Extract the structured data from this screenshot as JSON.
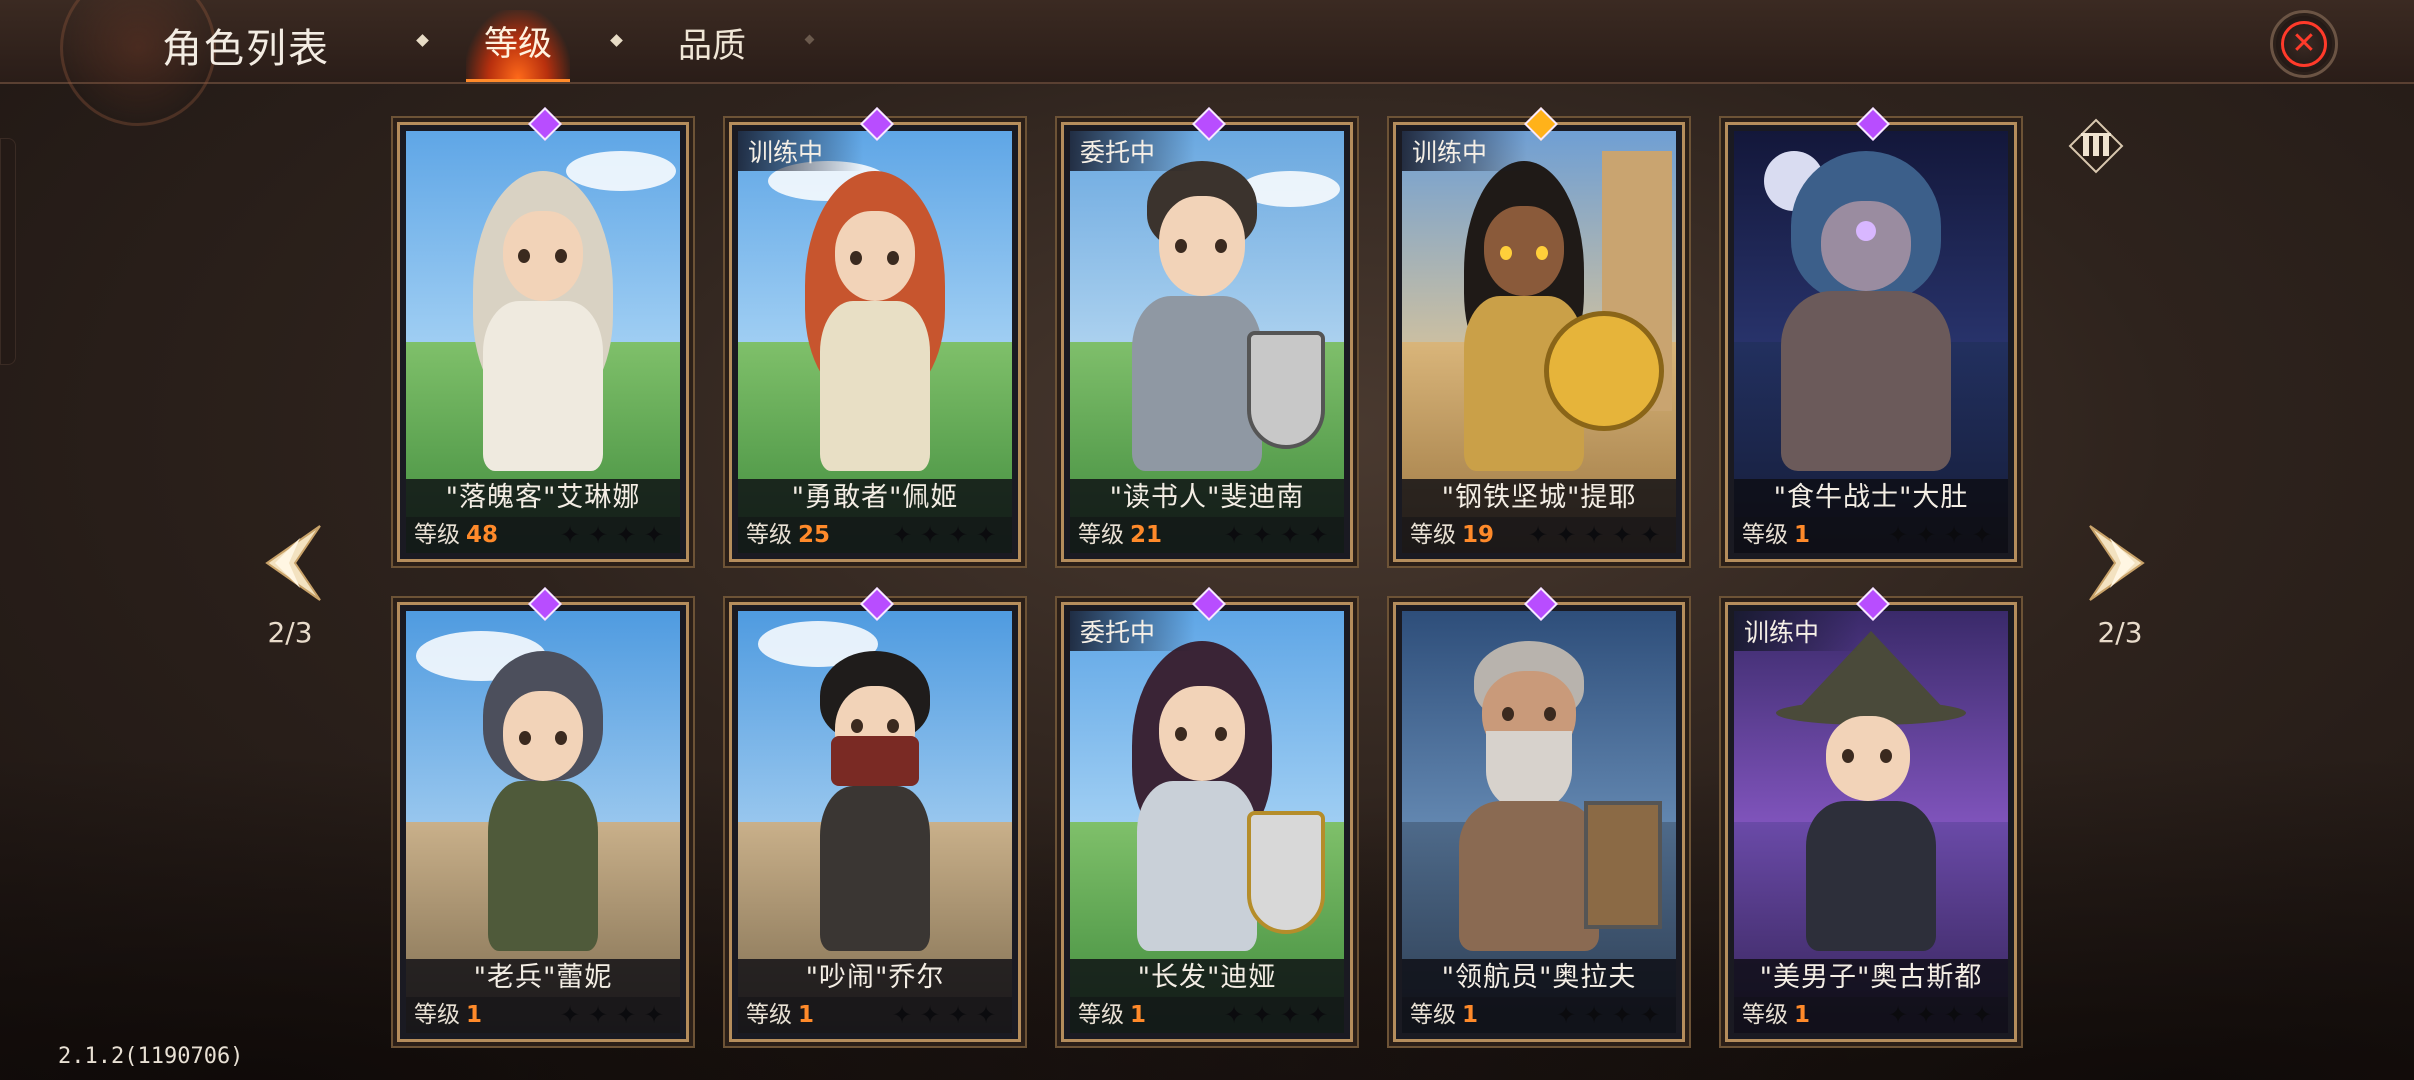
{
  "header": {
    "title": "角色列表",
    "tabs": [
      {
        "label": "等级",
        "active": true
      },
      {
        "label": "品质",
        "active": false
      }
    ]
  },
  "navigation": {
    "left_page": "2/3",
    "right_page": "2/3"
  },
  "version": "2.1.2(1190706)",
  "level_prefix": "等级",
  "cards": [
    {
      "name": "\"落魄客\"艾琳娜",
      "level": "48",
      "status": "",
      "gem": "purple",
      "stars": 4
    },
    {
      "name": "\"勇敢者\"佩姬",
      "level": "25",
      "status": "训练中",
      "gem": "purple",
      "stars": 4
    },
    {
      "name": "\"读书人\"斐迪南",
      "level": "21",
      "status": "委托中",
      "gem": "purple",
      "stars": 4
    },
    {
      "name": "\"钢铁坚城\"提耶",
      "level": "19",
      "status": "训练中",
      "gem": "gold",
      "stars": 5
    },
    {
      "name": "\"食牛战士\"大肚",
      "level": "1",
      "status": "",
      "gem": "purple",
      "stars": 4
    },
    {
      "name": "\"老兵\"蕾妮",
      "level": "1",
      "status": "",
      "gem": "purple",
      "stars": 4
    },
    {
      "name": "\"吵闹\"乔尔",
      "level": "1",
      "status": "",
      "gem": "purple",
      "stars": 4
    },
    {
      "name": "\"长发\"迪娅",
      "level": "1",
      "status": "委托中",
      "gem": "purple",
      "stars": 4
    },
    {
      "name": "\"领航员\"奥拉夫",
      "level": "1",
      "status": "",
      "gem": "purple",
      "stars": 4
    },
    {
      "name": "\"美男子\"奥古斯都",
      "level": "1",
      "status": "训练中",
      "gem": "purple",
      "stars": 4
    }
  ],
  "colors": {
    "gem_purple": "#b84dff",
    "gem_gold": "#ffb21a",
    "level_number": "#ff8a2a",
    "close_icon": "#ff3a2a",
    "active_tab_glow": "#ff6a1a"
  },
  "icons": {
    "close": "close-icon",
    "prev": "chevron-left-icon",
    "next": "chevron-right-icon",
    "sort": "sort-icon",
    "star": "star-icon",
    "gem": "diamond-gem-icon"
  }
}
